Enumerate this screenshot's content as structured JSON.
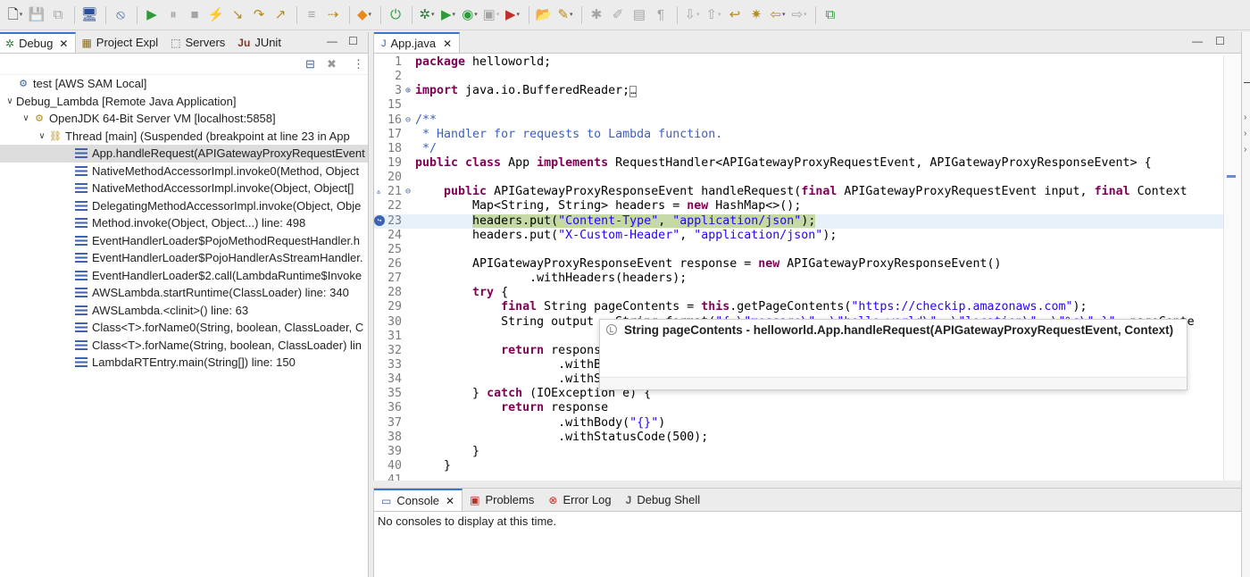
{
  "debug_view": {
    "tabs": [
      {
        "label": "Debug",
        "active": true
      },
      {
        "label": "Project Expl"
      },
      {
        "label": "Servers"
      },
      {
        "label": "JUnit"
      }
    ],
    "tree": [
      {
        "label": "test [AWS SAM Local]",
        "depth": 0,
        "icon": "launch-icon",
        "toggle": ""
      },
      {
        "label": "Debug_Lambda [Remote Java Application]",
        "depth": 0,
        "icon": "",
        "toggle": "v"
      },
      {
        "label": "OpenJDK 64-Bit Server VM [localhost:5858]",
        "depth": 1,
        "icon": "vm-icon",
        "toggle": "v"
      },
      {
        "label": "Thread [main] (Suspended (breakpoint at line 23 in App",
        "depth": 2,
        "icon": "thread-icon",
        "toggle": "v"
      },
      {
        "label": "App.handleRequest(APIGatewayProxyRequestEvent",
        "depth": 3,
        "icon": "frame-icon",
        "selected": true
      },
      {
        "label": "NativeMethodAccessorImpl.invoke0(Method, Object",
        "depth": 3,
        "icon": "frame-icon"
      },
      {
        "label": "NativeMethodAccessorImpl.invoke(Object, Object[]",
        "depth": 3,
        "icon": "frame-icon"
      },
      {
        "label": "DelegatingMethodAccessorImpl.invoke(Object, Obje",
        "depth": 3,
        "icon": "frame-icon"
      },
      {
        "label": "Method.invoke(Object, Object...) line: 498",
        "depth": 3,
        "icon": "frame-icon"
      },
      {
        "label": "EventHandlerLoader$PojoMethodRequestHandler.h",
        "depth": 3,
        "icon": "frame-icon"
      },
      {
        "label": "EventHandlerLoader$PojoHandlerAsStreamHandler.",
        "depth": 3,
        "icon": "frame-icon"
      },
      {
        "label": "EventHandlerLoader$2.call(LambdaRuntime$Invoke",
        "depth": 3,
        "icon": "frame-icon"
      },
      {
        "label": "AWSLambda.startRuntime(ClassLoader) line: 340",
        "depth": 3,
        "icon": "frame-icon"
      },
      {
        "label": "AWSLambda.<clinit>() line: 63",
        "depth": 3,
        "icon": "frame-icon"
      },
      {
        "label": "Class<T>.forName0(String, boolean, ClassLoader, C",
        "depth": 3,
        "icon": "frame-icon"
      },
      {
        "label": "Class<T>.forName(String, boolean, ClassLoader) lin",
        "depth": 3,
        "icon": "frame-icon"
      },
      {
        "label": "LambdaRTEntry.main(String[]) line: 150",
        "depth": 3,
        "icon": "frame-icon"
      }
    ]
  },
  "editor": {
    "tab_label": "App.java",
    "lines": [
      {
        "n": "1",
        "g": "",
        "html": "<span class=\"kw\">package</span> helloworld;"
      },
      {
        "n": "2",
        "g": "",
        "html": ""
      },
      {
        "n": "3",
        "g": "⊕",
        "html": "<span class=\"kw\">import</span> java.io.BufferedReader;<span style=\"border:1px solid #888;font-size:10px;\">…</span>"
      },
      {
        "n": "15",
        "g": "",
        "html": ""
      },
      {
        "n": "16",
        "g": "⊖",
        "html": "<span class=\"cmt\">/**</span>"
      },
      {
        "n": "17",
        "g": "",
        "html": "<span class=\"cmt\"> * Handler for requests to Lambda function.</span>"
      },
      {
        "n": "18",
        "g": "",
        "html": "<span class=\"cmt\"> */</span>"
      },
      {
        "n": "19",
        "g": "",
        "html": "<span class=\"kw\">public class</span> App <span class=\"kw\">implements</span> RequestHandler&lt;APIGatewayProxyRequestEvent, APIGatewayProxyResponseEvent&gt; {"
      },
      {
        "n": "20",
        "g": "",
        "html": ""
      },
      {
        "n": "21",
        "g": "⊖",
        "html": "    <span class=\"kw\">public</span> APIGatewayProxyResponseEvent handleRequest(<span class=\"kw\">final</span> APIGatewayProxyRequestEvent input, <span class=\"kw\">final</span> Context"
      },
      {
        "n": "22",
        "g": "",
        "html": "        Map&lt;String, String&gt; headers = <span class=\"kw\">new</span> HashMap&lt;&gt;();"
      },
      {
        "n": "23",
        "g": "",
        "hl": true,
        "html": "        <span class=\"hlbox\">headers.put(<span class=\"str\">\"Content-Type\"</span>, <span class=\"str\">\"application/json\"</span>);</span>"
      },
      {
        "n": "24",
        "g": "",
        "html": "        headers.put(<span class=\"str\">\"X-Custom-Header\"</span>, <span class=\"str\">\"application/json\"</span>);"
      },
      {
        "n": "25",
        "g": "",
        "html": ""
      },
      {
        "n": "26",
        "g": "",
        "html": "        APIGatewayProxyResponseEvent response = <span class=\"kw\">new</span> APIGatewayProxyResponseEvent()"
      },
      {
        "n": "27",
        "g": "",
        "html": "                .withHeaders(headers);"
      },
      {
        "n": "28",
        "g": "",
        "html": "        <span class=\"kw\">try</span> {"
      },
      {
        "n": "29",
        "g": "",
        "html": "            <span class=\"kw\">final</span> String pageContents = <span class=\"kw\">this</span>.getPageContents(<span class=\"str\">\"https://checkip.amazonaws.com\"</span>);"
      },
      {
        "n": "30",
        "g": "",
        "html": "            String output = String.format(<span class=\"str\">\"{ \\\"message\\\": \\\"hello world\\\", \\\"location\\\": \\\"%s\\\" }\"</span>, pageConte"
      },
      {
        "n": "31",
        "g": "",
        "html": ""
      },
      {
        "n": "32",
        "g": "",
        "html": "            <span class=\"kw\">return</span> response"
      },
      {
        "n": "33",
        "g": "",
        "html": "                    .withBody(output)"
      },
      {
        "n": "34",
        "g": "",
        "html": "                    .withStatusCode(200);"
      },
      {
        "n": "35",
        "g": "",
        "html": "        } <span class=\"kw\">catch</span> (IOException e) {"
      },
      {
        "n": "36",
        "g": "",
        "html": "            <span class=\"kw\">return</span> response"
      },
      {
        "n": "37",
        "g": "",
        "html": "                    .withBody(<span class=\"str\">\"{}\"</span>)"
      },
      {
        "n": "38",
        "g": "",
        "html": "                    .withStatusCode(500);"
      },
      {
        "n": "39",
        "g": "",
        "html": "        }"
      },
      {
        "n": "40",
        "g": "",
        "html": "    }"
      },
      {
        "n": "41",
        "g": "",
        "html": ""
      }
    ]
  },
  "tooltip": {
    "text": "String pageContents - helloworld.App.handleRequest(APIGatewayProxyRequestEvent, Context)"
  },
  "bottom": {
    "tabs": [
      {
        "label": "Console",
        "icon": "console-icon",
        "active": true
      },
      {
        "label": "Problems",
        "icon": "problems-icon"
      },
      {
        "label": "Error Log",
        "icon": "error-log-icon"
      },
      {
        "label": "Debug Shell",
        "icon": "debug-shell-icon"
      }
    ],
    "console_message": "No consoles to display at this time."
  },
  "colors": {
    "accent": "#3875d7",
    "keyword": "#7f0055",
    "string": "#2a00ff",
    "comment": "#3f5fbf",
    "current_line": "#c4d9a4",
    "frame_icon": "#3d62b5"
  }
}
